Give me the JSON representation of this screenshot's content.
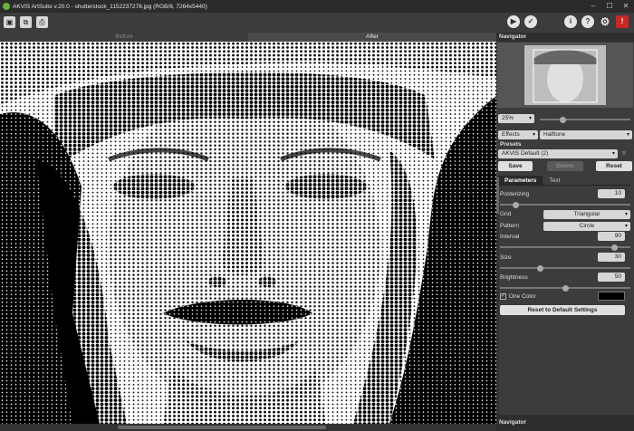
{
  "window": {
    "title": "AKVIS ArtSuite v.20.0 - shutterstock_1152237278.jpg (RGB/8, 7264x5440)",
    "controls": [
      "–",
      "☐",
      "✕"
    ]
  },
  "toolbar": {
    "left_icons": [
      "open-image-icon",
      "batch-icon",
      "print-icon"
    ],
    "right_icons": [
      "run-icon",
      "apply-icon",
      "info-icon",
      "help-icon",
      "settings-icon",
      "notifications-icon"
    ]
  },
  "view_tabs": {
    "before": "Before",
    "after": "After"
  },
  "navigator": {
    "title": "Navigator",
    "zoom": "25%"
  },
  "effects": {
    "label": "Effects",
    "value": "Halftone"
  },
  "presets": {
    "label": "Presets",
    "selected": "AKVIS Default (2)",
    "save": "Save",
    "delete": "Delete",
    "reset": "Reset"
  },
  "param_tabs": {
    "parameters": "Parameters",
    "text": "Text"
  },
  "params": {
    "posterizing": {
      "label": "Posterizing",
      "value": "10",
      "level": 0.1
    },
    "grid": {
      "label": "Grid",
      "value": "Triangular"
    },
    "pattern": {
      "label": "Pattern",
      "value": "Circle"
    },
    "interval": {
      "label": "Interval",
      "value": "90",
      "level": 0.9
    },
    "size": {
      "label": "Size",
      "value": "30",
      "level": 0.3
    },
    "brightness": {
      "label": "Brightness",
      "value": "50",
      "level": 0.5
    },
    "one_color": {
      "label": "One Color",
      "checked": true,
      "color": "#000000"
    }
  },
  "reset_defaults": "Reset to Default Settings",
  "bottom_panel": {
    "title": "Navigator"
  }
}
